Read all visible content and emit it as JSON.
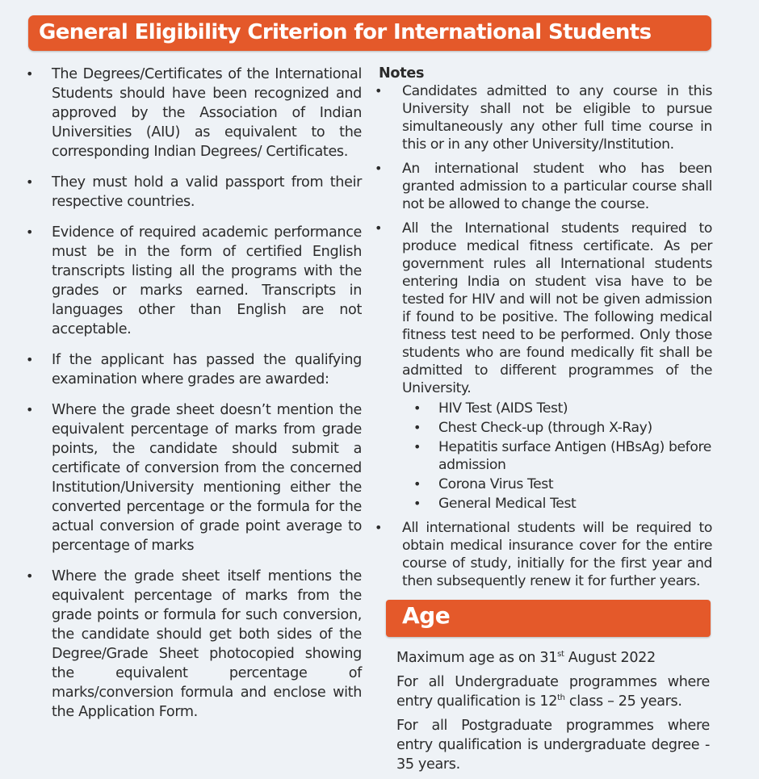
{
  "header": {
    "title": "General Eligibility Criterion for International Students"
  },
  "left_bullets": [
    "The Degrees/Certificates of the International Students should have been recognized and approved by the Association of Indian Universities (AIU) as equivalent to the corresponding Indian Degrees/ Certificates.",
    "They must hold a valid passport from their respective countries.",
    "Evidence of required academic performance must be in the form of certified English transcripts listing all the programs with the grades or marks earned. Transcripts in languages other than English are not acceptable.",
    "If the applicant has passed the qualifying examination where grades are awarded:",
    "Where the grade sheet doesn’t mention the equivalent percentage of marks from grade points, the candidate should submit a certificate of conversion from the concerned Institution/University mentioning either the converted percentage or the formula for the actual conversion of grade point average to percentage of marks",
    "Where the grade sheet itself mentions the equivalent percentage of marks from the grade points or formula for such conversion, the candidate should get both sides of the Degree/Grade Sheet photocopied showing the equivalent percentage of marks/conversion formula and enclose with the Application Form."
  ],
  "notes": {
    "heading": "Notes",
    "items": [
      "Candidates admitted to any course in this University shall not be eligible to pursue simultaneously any other full time course in this or in any other University/Institution.",
      "An international student who has been granted admission to a particular course shall not be allowed to change the course.",
      "All the International students required to produce medical fitness certificate. As per government rules all International students entering India on student visa have to be tested for HIV and will not be given admission if found to be positive. The following medical fitness test need to be performed. Only those students who are found medically fit shall be admitted to different programmes of the University.",
      "All international students will be required to obtain medical insurance cover for the entire course of study, initially for the first year and then subsequently renew it for further years."
    ],
    "medical_tests": [
      "HIV Test (AIDS Test)",
      "Chest Check-up (through X-Ray)",
      "Hepatitis surface Antigen (HBsAg) before admission",
      "Corona Virus Test",
      "General Medical Test"
    ]
  },
  "age": {
    "heading": "Age",
    "max_age_prefix": "Maximum age as on 31",
    "max_age_sup": "st",
    "max_age_suffix": " August 2022",
    "ug_prefix": "For all Undergraduate programmes where entry qualification is 12",
    "ug_sup": "th",
    "ug_suffix": " class – 25 years.",
    "pg_text": "For all Postgraduate programmes where entry qualification is undergraduate degree - 35 years."
  },
  "bullet_char": "•",
  "colors": {
    "accent": "#e4592a",
    "background": "#eef2f6",
    "text": "#2b2b2b"
  }
}
